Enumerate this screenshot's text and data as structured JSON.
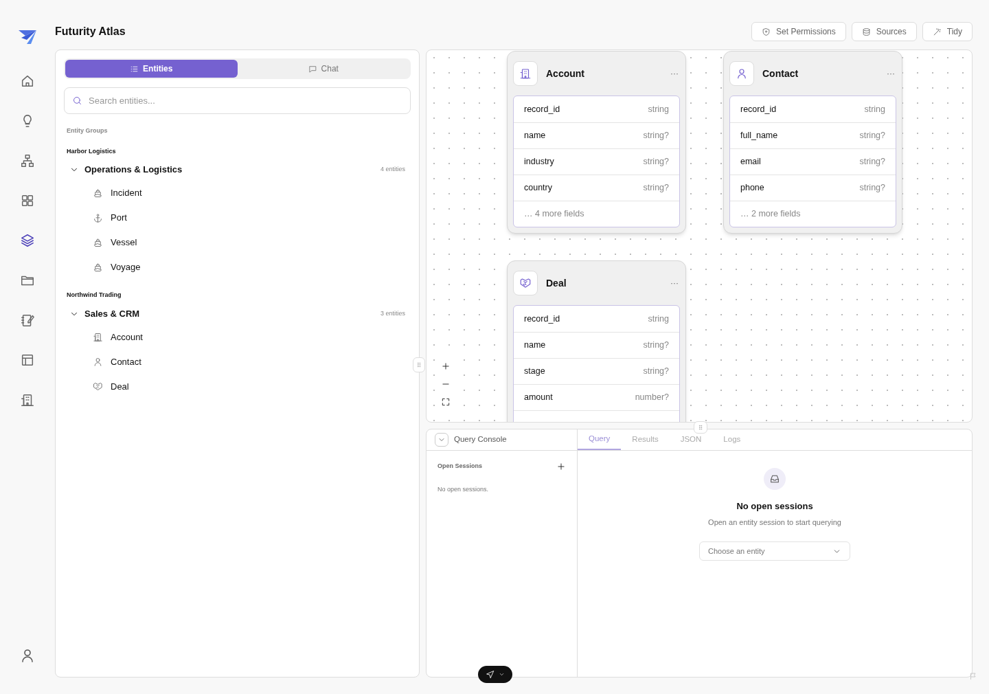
{
  "app": {
    "title": "Futurity Atlas"
  },
  "nav": [
    {
      "kind": "home",
      "selected": false
    },
    {
      "kind": "bulb",
      "selected": false
    },
    {
      "kind": "sitemap",
      "selected": false
    },
    {
      "kind": "grid",
      "selected": false
    },
    {
      "kind": "layers",
      "selected": true
    },
    {
      "kind": "folder",
      "selected": false
    },
    {
      "kind": "notebook",
      "selected": false
    },
    {
      "kind": "table",
      "selected": false
    },
    {
      "kind": "building",
      "selected": false
    }
  ],
  "toolbar": [
    {
      "kind": "shield",
      "label": "Set Permissions"
    },
    {
      "kind": "database",
      "label": "Sources"
    },
    {
      "kind": "wand",
      "label": "Tidy"
    }
  ],
  "panel_tabs": [
    {
      "kind": "list",
      "label": "Entities",
      "selected": true
    },
    {
      "kind": "chat",
      "label": "Chat",
      "selected": false
    }
  ],
  "search": {
    "placeholder": "Search entities..."
  },
  "entity_groups_label": "Entity Groups",
  "groups": [
    {
      "org": "Harbor Logistics",
      "name": "Operations & Logistics",
      "count": "4 entities",
      "expanded": true,
      "children": [
        {
          "kind": "ship",
          "label": "Incident"
        },
        {
          "kind": "anchor",
          "label": "Port"
        },
        {
          "kind": "ship",
          "label": "Vessel"
        },
        {
          "kind": "ship",
          "label": "Voyage"
        }
      ]
    },
    {
      "org": "Northwind Trading",
      "name": "Sales & CRM",
      "count": "3 entities",
      "expanded": true,
      "children": [
        {
          "kind": "building",
          "label": "Account"
        },
        {
          "kind": "user",
          "label": "Contact"
        },
        {
          "kind": "handshake",
          "label": "Deal"
        }
      ]
    }
  ],
  "nodes": [
    {
      "kind": "building",
      "title": "Account",
      "menu": "···",
      "fields": [
        {
          "name": "record_id",
          "type": "string"
        },
        {
          "name": "name",
          "type": "string?"
        },
        {
          "name": "industry",
          "type": "string?"
        },
        {
          "name": "country",
          "type": "string?"
        }
      ],
      "more": "… 4 more fields"
    },
    {
      "kind": "user",
      "title": "Contact",
      "menu": "···",
      "fields": [
        {
          "name": "record_id",
          "type": "string"
        },
        {
          "name": "full_name",
          "type": "string?"
        },
        {
          "name": "email",
          "type": "string?"
        },
        {
          "name": "phone",
          "type": "string?"
        }
      ],
      "more": "… 2 more fields"
    },
    {
      "kind": "handshake",
      "title": "Deal",
      "menu": "···",
      "fields": [
        {
          "name": "record_id",
          "type": "string"
        },
        {
          "name": "name",
          "type": "string?"
        },
        {
          "name": "stage",
          "type": "string?"
        },
        {
          "name": "amount",
          "type": "number?"
        }
      ]
    }
  ],
  "console": {
    "title": "Query Console",
    "sessions_label": "Open Sessions",
    "sessions_empty": "No open sessions.",
    "tabs": [
      {
        "label": "Query",
        "selected": true
      },
      {
        "label": "Results",
        "selected": false
      },
      {
        "label": "JSON",
        "selected": false
      },
      {
        "label": "Logs",
        "selected": false
      }
    ],
    "empty_title": "No open sessions",
    "empty_text": "Open an entity session to start querying",
    "select": {
      "placeholder": "Choose an entity"
    }
  }
}
